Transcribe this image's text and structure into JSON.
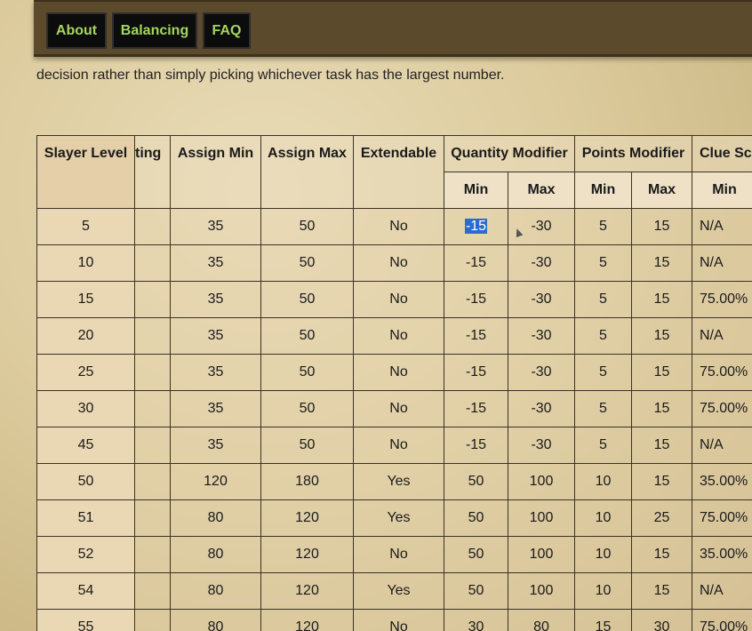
{
  "nav": {
    "items": [
      {
        "label": "About"
      },
      {
        "label": "Balancing"
      },
      {
        "label": "FAQ"
      }
    ]
  },
  "intro": {
    "text": "decision rather than simply picking whichever task has the largest number."
  },
  "table": {
    "headers": {
      "slayer_level": "Slayer Level",
      "weighting": "ting",
      "assign_min": "Assign Min",
      "assign_max": "Assign Max",
      "extendable": "Extendable",
      "quantity_modifier": "Quantity Modifier",
      "points_modifier": "Points Modifier",
      "clue_scroll": "Clue Sc"
    },
    "subheaders": {
      "qty_min": "Min",
      "qty_max": "Max",
      "pts_min": "Min",
      "pts_max": "Max",
      "clue_min": "Min"
    },
    "rows": [
      {
        "level": "5",
        "weighting": "",
        "assign_min": "35",
        "assign_max": "50",
        "extendable": "No",
        "qty_min": "-15",
        "qty_max": "-30",
        "pts_min": "5",
        "pts_max": "15",
        "clue_min": "N/A"
      },
      {
        "level": "10",
        "weighting": "",
        "assign_min": "35",
        "assign_max": "50",
        "extendable": "No",
        "qty_min": "-15",
        "qty_max": "-30",
        "pts_min": "5",
        "pts_max": "15",
        "clue_min": "N/A"
      },
      {
        "level": "15",
        "weighting": "",
        "assign_min": "35",
        "assign_max": "50",
        "extendable": "No",
        "qty_min": "-15",
        "qty_max": "-30",
        "pts_min": "5",
        "pts_max": "15",
        "clue_min": "75.00%"
      },
      {
        "level": "20",
        "weighting": "",
        "assign_min": "35",
        "assign_max": "50",
        "extendable": "No",
        "qty_min": "-15",
        "qty_max": "-30",
        "pts_min": "5",
        "pts_max": "15",
        "clue_min": "N/A"
      },
      {
        "level": "25",
        "weighting": "",
        "assign_min": "35",
        "assign_max": "50",
        "extendable": "No",
        "qty_min": "-15",
        "qty_max": "-30",
        "pts_min": "5",
        "pts_max": "15",
        "clue_min": "75.00%"
      },
      {
        "level": "30",
        "weighting": "",
        "assign_min": "35",
        "assign_max": "50",
        "extendable": "No",
        "qty_min": "-15",
        "qty_max": "-30",
        "pts_min": "5",
        "pts_max": "15",
        "clue_min": "75.00%"
      },
      {
        "level": "45",
        "weighting": "",
        "assign_min": "35",
        "assign_max": "50",
        "extendable": "No",
        "qty_min": "-15",
        "qty_max": "-30",
        "pts_min": "5",
        "pts_max": "15",
        "clue_min": "N/A"
      },
      {
        "level": "50",
        "weighting": "",
        "assign_min": "120",
        "assign_max": "180",
        "extendable": "Yes",
        "qty_min": "50",
        "qty_max": "100",
        "pts_min": "10",
        "pts_max": "15",
        "clue_min": "35.00%"
      },
      {
        "level": "51",
        "weighting": "",
        "assign_min": "80",
        "assign_max": "120",
        "extendable": "Yes",
        "qty_min": "50",
        "qty_max": "100",
        "pts_min": "10",
        "pts_max": "25",
        "clue_min": "75.00%"
      },
      {
        "level": "52",
        "weighting": "",
        "assign_min": "80",
        "assign_max": "120",
        "extendable": "No",
        "qty_min": "50",
        "qty_max": "100",
        "pts_min": "10",
        "pts_max": "15",
        "clue_min": "35.00%"
      },
      {
        "level": "54",
        "weighting": "",
        "assign_min": "80",
        "assign_max": "120",
        "extendable": "Yes",
        "qty_min": "50",
        "qty_max": "100",
        "pts_min": "10",
        "pts_max": "15",
        "clue_min": "N/A"
      },
      {
        "level": "55",
        "weighting": "",
        "assign_min": "80",
        "assign_max": "120",
        "extendable": "No",
        "qty_min": "30",
        "qty_max": "80",
        "pts_min": "15",
        "pts_max": "30",
        "clue_min": "75.00%"
      }
    ]
  }
}
